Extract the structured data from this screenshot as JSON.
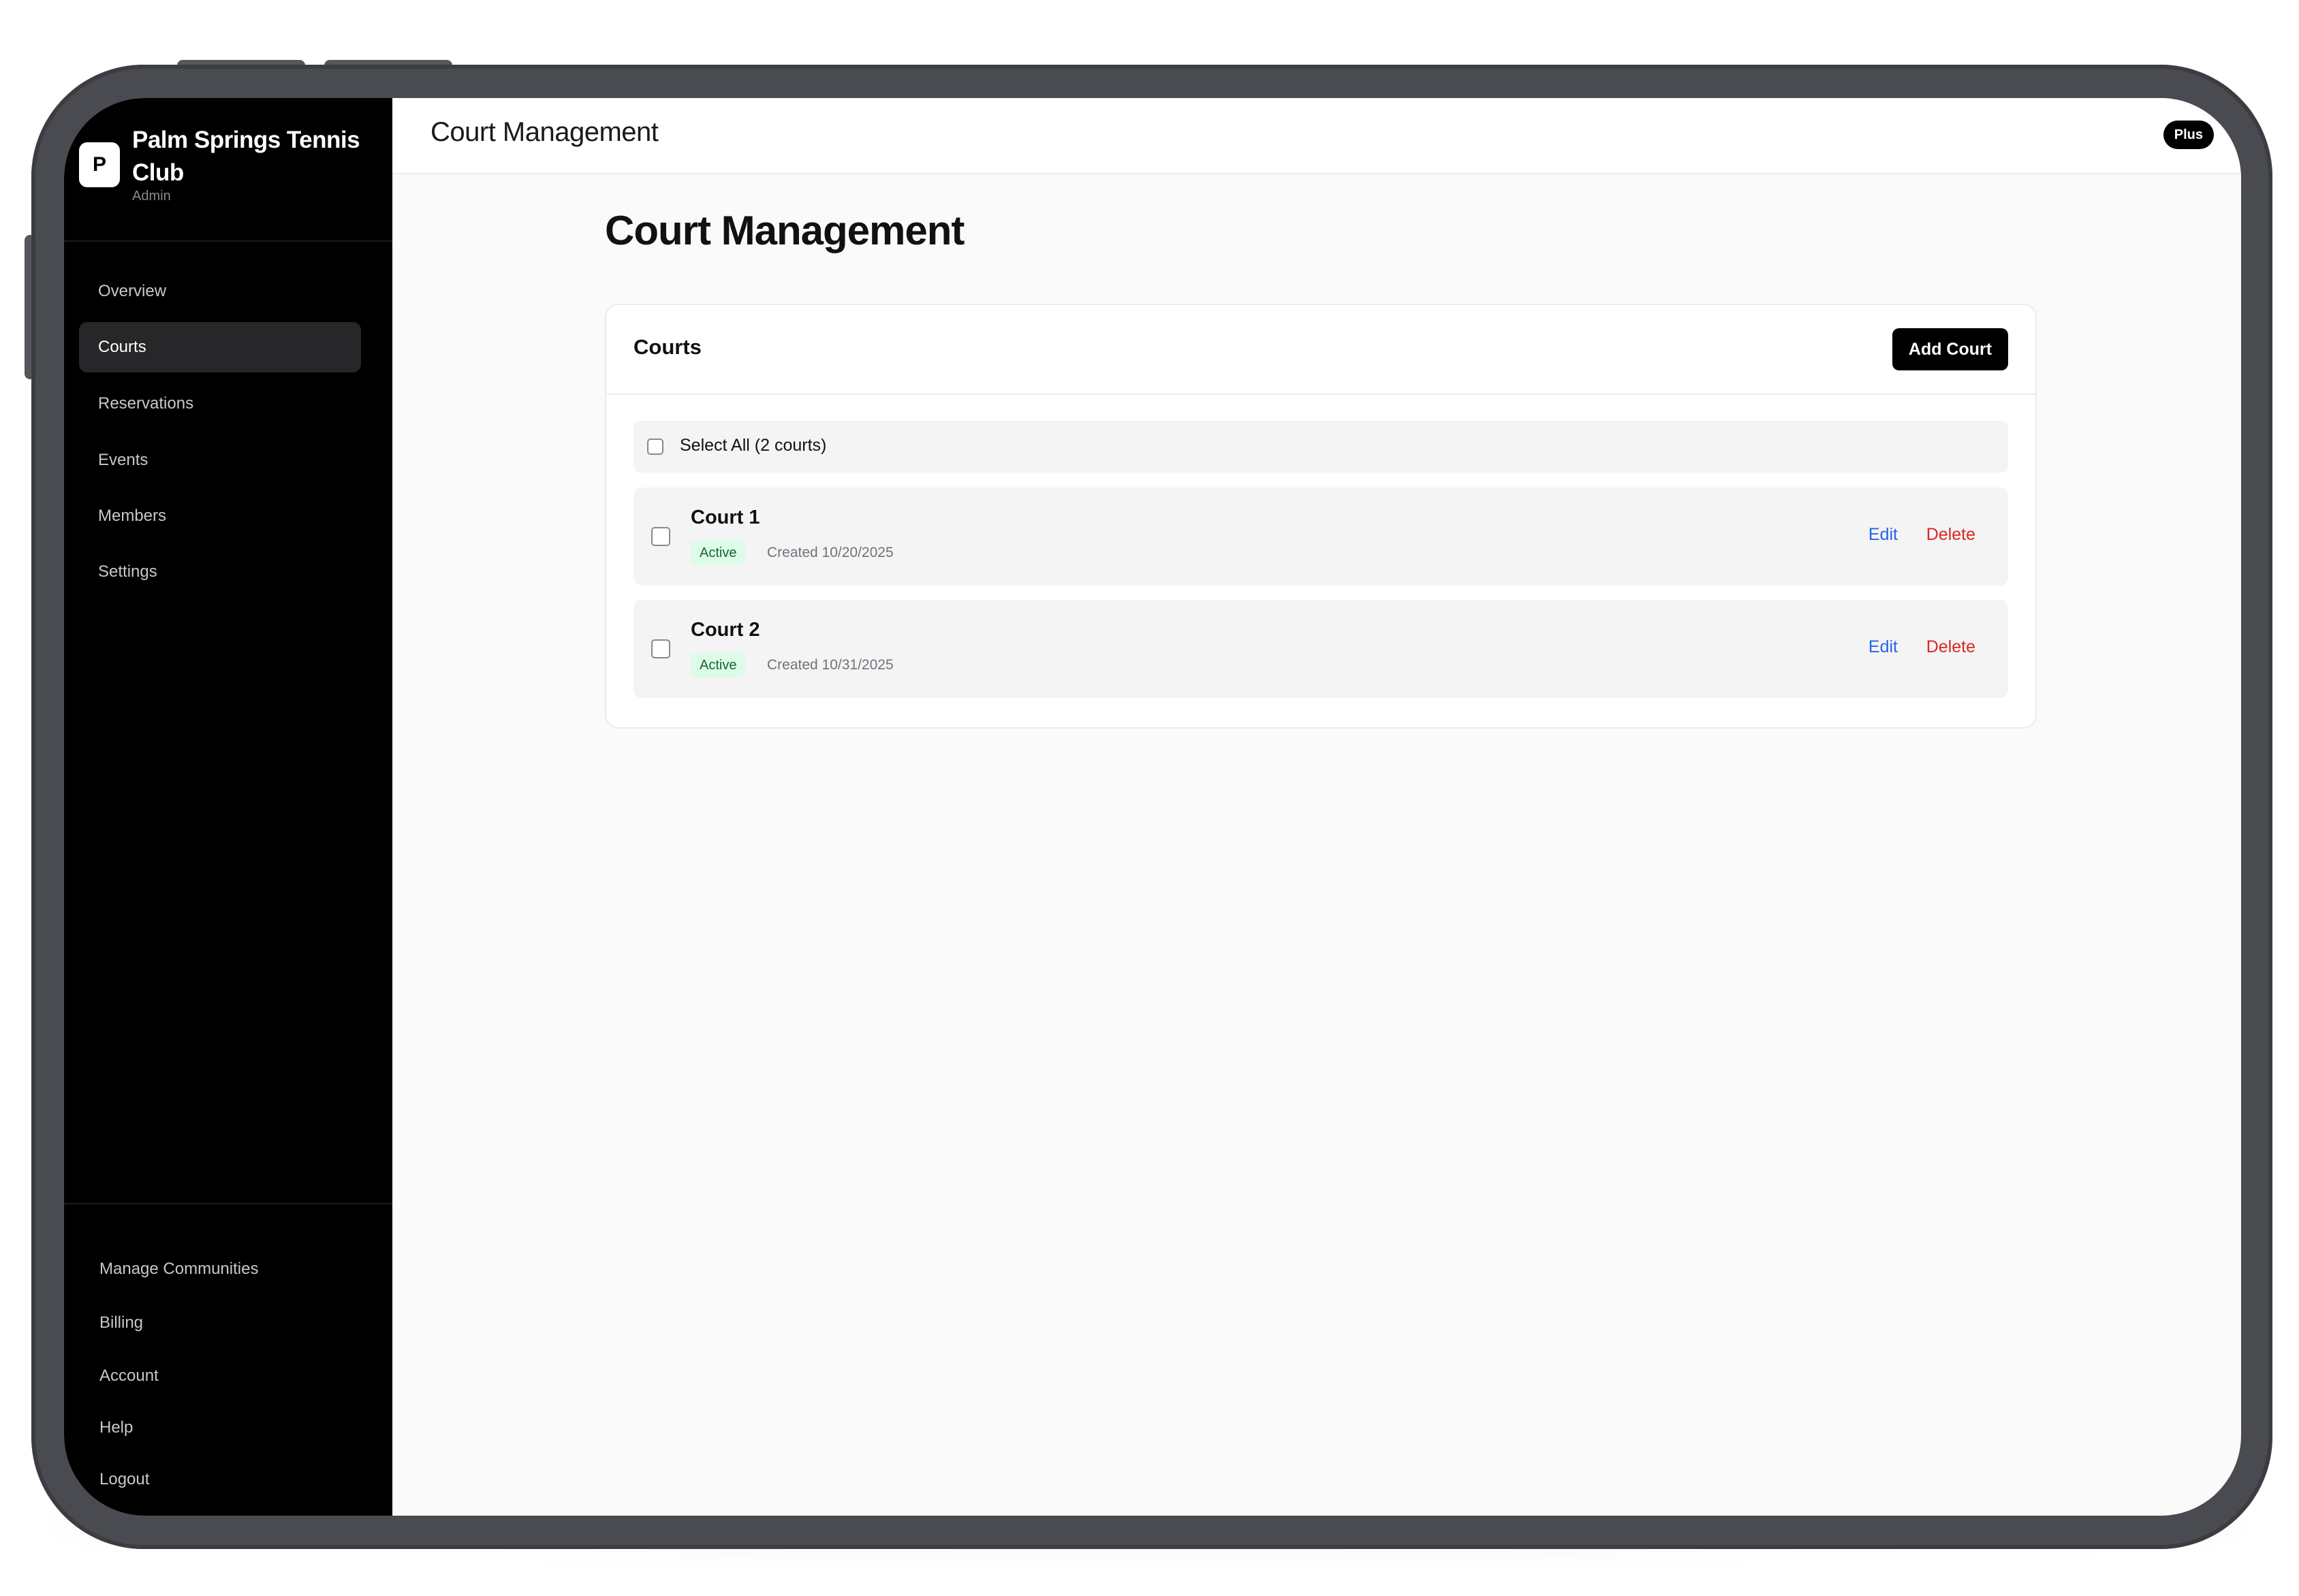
{
  "sidebar": {
    "logo_letter": "P",
    "club_name": "Palm Springs Tennis Club",
    "role": "Admin",
    "nav": [
      {
        "label": "Overview"
      },
      {
        "label": "Courts",
        "active": true
      },
      {
        "label": "Reservations"
      },
      {
        "label": "Events"
      },
      {
        "label": "Members"
      },
      {
        "label": "Settings"
      }
    ],
    "footer": [
      {
        "label": "Manage Communities"
      },
      {
        "label": "Billing"
      },
      {
        "label": "Account"
      },
      {
        "label": "Help"
      },
      {
        "label": "Logout"
      }
    ]
  },
  "header": {
    "title": "Court Management",
    "plan_badge": "Plus"
  },
  "main": {
    "heading": "Court Management",
    "card": {
      "title": "Courts",
      "add_button": "Add Court",
      "select_all_label": "Select All (2 courts)",
      "courts": [
        {
          "name": "Court 1",
          "status": "Active",
          "created": "Created 10/20/2025",
          "checked": false
        },
        {
          "name": "Court 2",
          "status": "Active",
          "created": "Created 10/31/2025",
          "checked": false
        }
      ],
      "edit_label": "Edit",
      "delete_label": "Delete"
    }
  },
  "colors": {
    "sidebar_bg": "#000000",
    "active_nav_bg": "#27272a",
    "status_bg": "#dcfce7",
    "status_text": "#166534",
    "edit_link": "#2563eb",
    "delete_link": "#dc2626",
    "primary_button": "#000000"
  },
  "icons": {
    "checkbox": "checkbox-unchecked-icon"
  }
}
